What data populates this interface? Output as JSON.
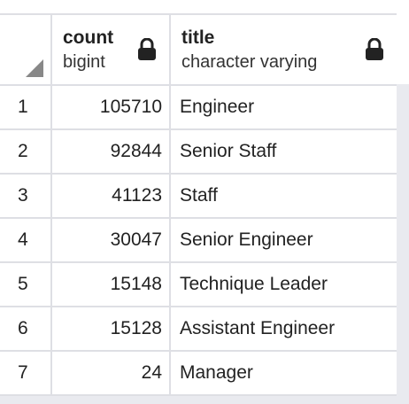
{
  "columns": [
    {
      "name": "count",
      "type": "bigint"
    },
    {
      "name": "title",
      "type": "character varying"
    }
  ],
  "rows": [
    {
      "n": "1",
      "count": "105710",
      "title": "Engineer"
    },
    {
      "n": "2",
      "count": "92844",
      "title": "Senior Staff"
    },
    {
      "n": "3",
      "count": "41123",
      "title": "Staff"
    },
    {
      "n": "4",
      "count": "30047",
      "title": "Senior Engineer"
    },
    {
      "n": "5",
      "count": "15148",
      "title": "Technique Leader"
    },
    {
      "n": "6",
      "count": "15128",
      "title": "Assistant Engineer"
    },
    {
      "n": "7",
      "count": "24",
      "title": "Manager"
    }
  ]
}
